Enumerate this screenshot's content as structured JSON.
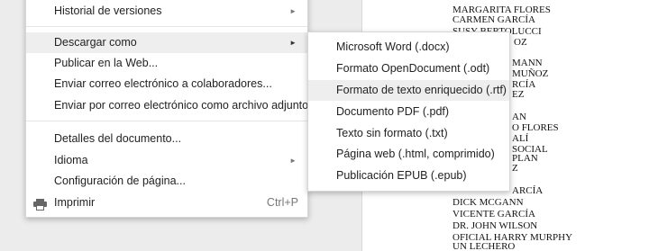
{
  "document": {
    "lines": [
      "MARGARITA FLORES",
      "CARMEN GARCÍA",
      "SUSY BERTOLUCCI",
      "OZ",
      "MANN",
      "MUÑOZ",
      "RCÍA",
      "EZ",
      "AN",
      "O FLORES",
      "ALÍ",
      "SOCIAL",
      "PLAN",
      "Z",
      "ARCÍA",
      "DICK MCGANN",
      "VICENTE GARCÍA",
      "DR. JOHN WILSON",
      "OFICIAL HARRY MURPHY",
      "UN LECHERO"
    ]
  },
  "menu": {
    "items": [
      {
        "label": "Historial de versiones",
        "has_submenu": true
      },
      {
        "label": "Descargar como",
        "has_submenu": true
      },
      {
        "label": "Publicar en la Web..."
      },
      {
        "label": "Enviar correo electrónico a colaboradores..."
      },
      {
        "label": "Enviar por correo electrónico como archivo adjunto..."
      },
      {
        "label": "Detalles del documento..."
      },
      {
        "label": "Idioma",
        "has_submenu": true
      },
      {
        "label": "Configuración de página..."
      },
      {
        "label": "Imprimir",
        "shortcut": "Ctrl+P",
        "icon": "print-icon"
      }
    ],
    "submenu_arrow": "►"
  },
  "submenu": {
    "items": [
      {
        "label": "Microsoft Word (.docx)"
      },
      {
        "label": "Formato OpenDocument (.odt)"
      },
      {
        "label": "Formato de texto enriquecido (.rtf)"
      },
      {
        "label": "Documento PDF (.pdf)"
      },
      {
        "label": "Texto sin formato (.txt)"
      },
      {
        "label": "Página web (.html, comprimido)"
      },
      {
        "label": "Publicación EPUB (.epub)"
      }
    ]
  },
  "colors": {
    "active_bg": "#eeeeee",
    "text": "#222222",
    "muted": "#777777"
  }
}
